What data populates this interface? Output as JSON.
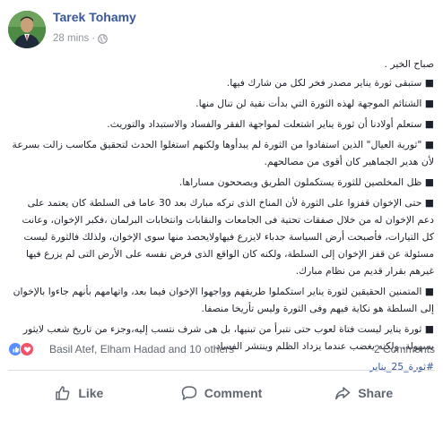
{
  "author": {
    "name": "Tarek Tohamy",
    "time": "28 mins",
    "separator": "·",
    "privacy_icon": "globe-icon"
  },
  "post": {
    "greeting": "صباح الخير .",
    "paragraphs": [
      "■ ستبقى ثورة يناير مصدر فخر لكل من شارك فيها.",
      "■ الشتائم الموجهة لهذه الثورة التي بدأت نقية لن تنال منها.",
      "■ ستعلم أولادنا أن ثورة يناير اشتعلت لمواجهة الفقر والفساد والاستبداد والتوريث.",
      "■ \"ثورية العيال\" الذين استفادوا من الثورة لم يبدأوها ولكنهم استغلوا الحدث لتحقيق مكاسب زالت بسرعة لأن هدير الجماهير كان أقوى من مصالحهم.",
      "■ ظل المخلصين للثورة يستكملون الطريق ويصححون مساراها.",
      "■ حتى الإخوان قفزوا على الثورة لأن المناخ الذى تركه مبارك بعد 30 عاما فى السلطة كان يعتمد على دعم الإخوان له من خلال صفقات تحتية فى الجامعات والنقابات وانتخابات البرلمان ،فكبر الإخوان، وعانت كل التيارات، فأصبحت أرض السياسة جدباء لايزرع فيهاولايحصد منها سوى الإخوان، ولذلك فالثورة ليست مسئولة عن قفز الإخوان إلى السلطة، ولكنه كان الواقع الذى فرض نفسه على الأرض التى لم يزرع فيها غيرهم بقرار قديم من نظام مبارك.",
      "■ المتمنين الحقيقين لثورة يناير استكملوا طريقهم وواجهوا الإخوان فيما بعد، واتهامهم بأنهم جاءوا بالإخوان إلى السلطة هو نكاية فيهم وفى الثورة وليس تأريخا منصفا.",
      "■ ثورة يناير ليست فتاة لعوب حتى نتبرأ من تبنيها، بل هى شرف نتسب إليه،وجزء من تاريخ شعب لايثور بسهولة، ولكنه يغضب عندما يزداد الظلم وينتشر الفساد."
    ],
    "hashtag": "#ثورة_25_يناير"
  },
  "reactions": {
    "names": "Basil Atef, Elham Hadad and 10 others",
    "comments": "2 Comments",
    "icons": [
      "like-reaction-icon",
      "love-reaction-icon"
    ]
  },
  "actions": {
    "like": "Like",
    "comment": "Comment",
    "share": "Share"
  },
  "colors": {
    "link": "#385898",
    "muted": "#90949c",
    "action": "#606770",
    "like_blue": "#5890ff",
    "love_red": "#f25268"
  }
}
